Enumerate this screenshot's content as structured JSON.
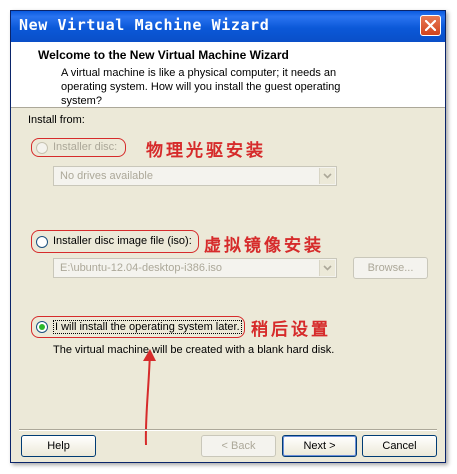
{
  "window": {
    "title": "New Virtual Machine Wizard"
  },
  "header": {
    "title": "Welcome to the New Virtual Machine Wizard",
    "description": "A virtual machine is like a physical computer; it needs an operating system. How will you install the guest operating system?"
  },
  "install_from": {
    "label": "Install from:",
    "disc": {
      "label": "Installer disc:",
      "selected": false,
      "enabled": false,
      "dropdown_value": "No drives available"
    },
    "iso": {
      "label": "Installer disc image file (iso):",
      "selected": false,
      "enabled": true,
      "path_value": "E:\\ubuntu-12.04-desktop-i386.iso",
      "browse_label": "Browse..."
    },
    "later": {
      "label": "I will install the operating system later.",
      "selected": true,
      "enabled": true,
      "description": "The virtual machine will be created with a blank hard disk."
    }
  },
  "annotations": {
    "disc": "物理光驱安装",
    "iso": "虚拟镜像安装",
    "later": "稍后设置",
    "color": "#d62b2b"
  },
  "footer": {
    "help": "Help",
    "back": "< Back",
    "next": "Next >",
    "cancel": "Cancel"
  },
  "colors": {
    "title_bar": "#0a5ae0",
    "dialog_bg": "#ece9d8",
    "selected_dot": "#2cb82c"
  },
  "icons": {
    "close": "close-icon",
    "dropdown": "chevron-down-icon"
  }
}
